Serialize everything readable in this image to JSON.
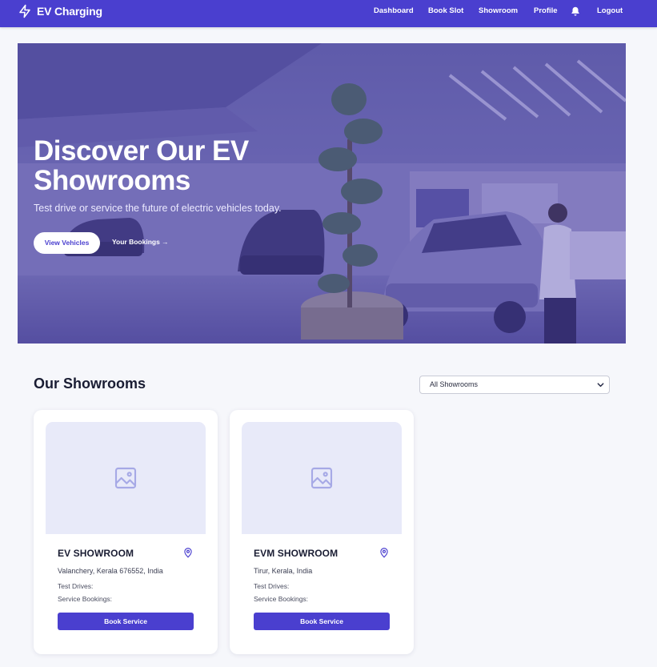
{
  "app": {
    "title": "EV Charging"
  },
  "nav": {
    "links": [
      "Dashboard",
      "Book Slot",
      "Showroom",
      "Profile"
    ],
    "logout": "Logout"
  },
  "hero": {
    "title": "Discover Our EV Showrooms",
    "subtitle": "Test drive or service the future of electric vehicles today.",
    "primary_button": "View Vehicles",
    "secondary_link": "Your Bookings →"
  },
  "showrooms_section": {
    "title": "Our Showrooms",
    "filter": {
      "selected": "All Showrooms"
    }
  },
  "showrooms": [
    {
      "name": "EV SHOWROOM",
      "address": "Valanchery, Kerala 676552, India",
      "test_drives_label": "Test Drives:",
      "service_bookings_label": "Service Bookings:",
      "button": "Book Service"
    },
    {
      "name": "EVM SHOWROOM",
      "address": "Tirur, Kerala, India",
      "test_drives_label": "Test Drives:",
      "service_bookings_label": "Service Bookings:",
      "button": "Book Service"
    }
  ],
  "colors": {
    "primary": "#4a3fcf",
    "placeholder_bg": "#e8eaf9",
    "page_bg": "#f6f7fb"
  },
  "icons": {
    "brand": "lightning-icon",
    "notifications": "bell-icon",
    "dropdown": "chevron-down-icon",
    "image_placeholder": "image-icon",
    "location": "map-pin-icon"
  }
}
